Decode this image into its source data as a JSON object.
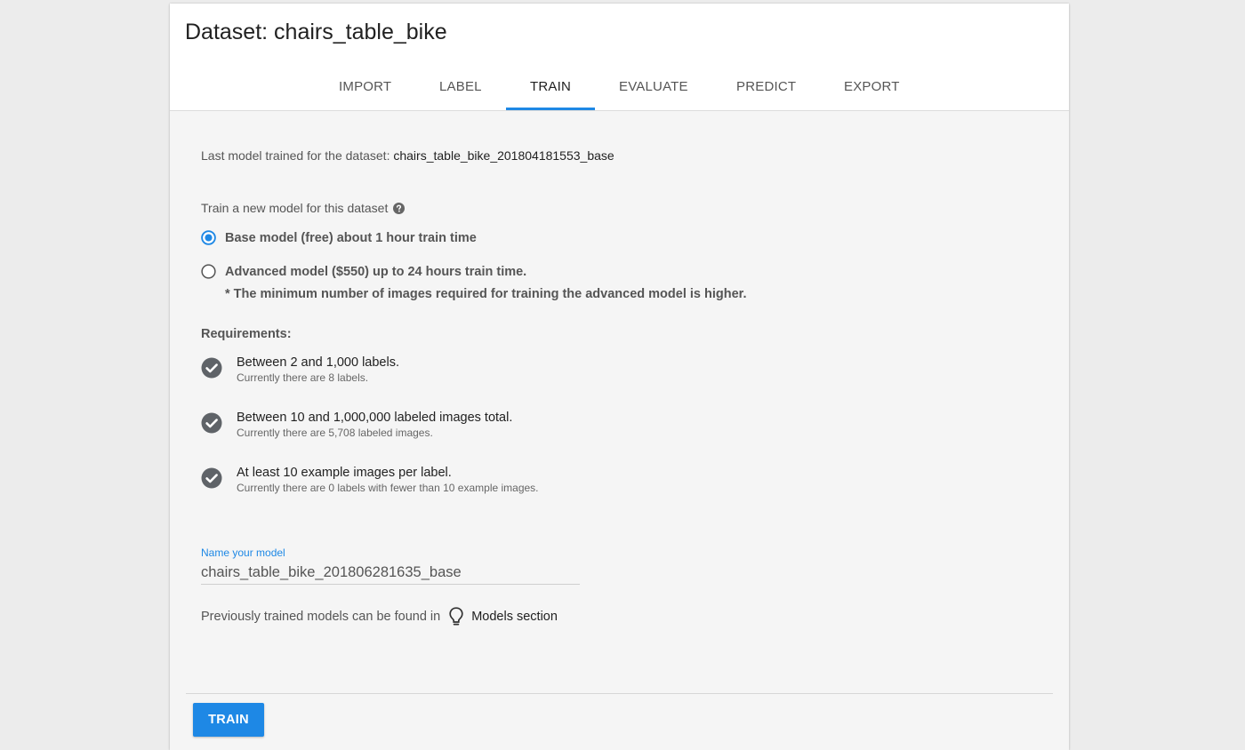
{
  "colors": {
    "accent": "#1e88e5",
    "check": "#5f6368"
  },
  "header": {
    "title": "Dataset: chairs_table_bike",
    "tabs": [
      {
        "label": "IMPORT"
      },
      {
        "label": "LABEL"
      },
      {
        "label": "TRAIN",
        "active": true
      },
      {
        "label": "EVALUATE"
      },
      {
        "label": "PREDICT"
      },
      {
        "label": "EXPORT"
      }
    ]
  },
  "main": {
    "last_model_label": "Last model trained for the dataset:",
    "last_model_value": "chairs_table_bike_201804181553_base",
    "train_new_label": "Train a new model for this dataset",
    "help_icon": "help-circle-icon",
    "options": [
      {
        "label": "Base model (free) about 1 hour train time",
        "selected": true
      },
      {
        "label": "Advanced model ($550) up to 24 hours train time.",
        "selected": false
      }
    ],
    "advanced_note": "* The minimum number of images required for training the advanced model is higher.",
    "requirements_heading": "Requirements:",
    "requirements": [
      {
        "title": "Between 2 and 1,000 labels.",
        "detail": "Currently there are 8 labels.",
        "icon": "check-circle-icon"
      },
      {
        "title": "Between 10 and 1,000,000 labeled images total.",
        "detail": "Currently there are 5,708 labeled images.",
        "icon": "check-circle-icon"
      },
      {
        "title": "At least 10 example images per label.",
        "detail": "Currently there are 0 labels with fewer than 10 example images.",
        "icon": "check-circle-icon"
      }
    ],
    "name_label": "Name your model",
    "name_value": "chairs_table_bike_201806281635_base",
    "previous_text": "Previously trained models can be found in",
    "models_icon": "lightbulb-icon",
    "models_link": "Models section"
  },
  "footer": {
    "train_button": "TRAIN"
  }
}
